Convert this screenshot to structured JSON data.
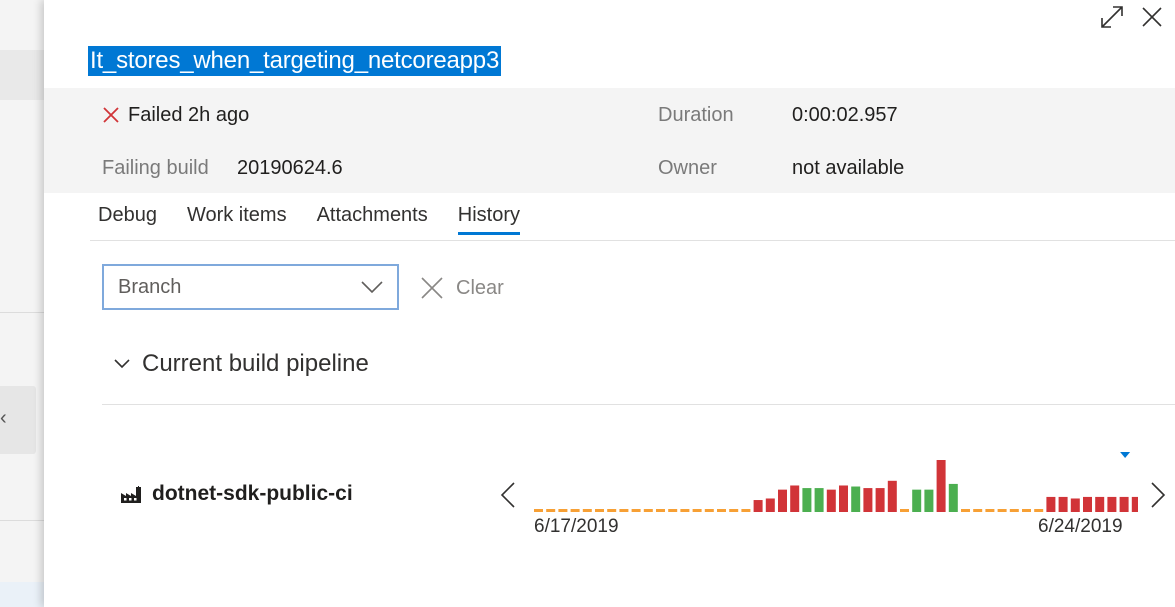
{
  "test": {
    "title": "It_stores_when_targeting_netcoreapp3"
  },
  "summary": {
    "status": "Failed 2h ago",
    "duration_label": "Duration",
    "duration_value": "0:00:02.957",
    "failing_build_label": "Failing build",
    "failing_build_value": "20190624.6",
    "owner_label": "Owner",
    "owner_value": "not available"
  },
  "tabs": [
    {
      "label": "Debug"
    },
    {
      "label": "Work items"
    },
    {
      "label": "Attachments"
    },
    {
      "label": "History",
      "active": true
    }
  ],
  "filters": {
    "branch_placeholder": "Branch",
    "clear_label": "Clear"
  },
  "section": {
    "label": "Current build pipeline"
  },
  "pipeline": {
    "name": "dotnet-sdk-public-ci"
  },
  "history": {
    "start_date": "6/17/2019",
    "end_date": "6/24/2019",
    "colors": {
      "failed": "#d13438",
      "passed": "#4caf50",
      "none": "#f7a035",
      "selected": "#0078d4"
    },
    "runs": [
      {
        "result": "none",
        "duration": 0
      },
      {
        "result": "none",
        "duration": 0
      },
      {
        "result": "none",
        "duration": 0
      },
      {
        "result": "none",
        "duration": 0
      },
      {
        "result": "none",
        "duration": 0
      },
      {
        "result": "none",
        "duration": 0
      },
      {
        "result": "none",
        "duration": 0
      },
      {
        "result": "none",
        "duration": 0
      },
      {
        "result": "none",
        "duration": 0
      },
      {
        "result": "none",
        "duration": 0
      },
      {
        "result": "none",
        "duration": 0
      },
      {
        "result": "none",
        "duration": 0
      },
      {
        "result": "none",
        "duration": 0
      },
      {
        "result": "none",
        "duration": 0
      },
      {
        "result": "none",
        "duration": 0
      },
      {
        "result": "none",
        "duration": 0
      },
      {
        "result": "none",
        "duration": 0
      },
      {
        "result": "none",
        "duration": 0
      },
      {
        "result": "failed",
        "duration": 0.23
      },
      {
        "result": "failed",
        "duration": 0.26
      },
      {
        "result": "failed",
        "duration": 0.43
      },
      {
        "result": "failed",
        "duration": 0.51
      },
      {
        "result": "passed",
        "duration": 0.46
      },
      {
        "result": "passed",
        "duration": 0.46
      },
      {
        "result": "failed",
        "duration": 0.43
      },
      {
        "result": "failed",
        "duration": 0.51
      },
      {
        "result": "passed",
        "duration": 0.49
      },
      {
        "result": "failed",
        "duration": 0.46
      },
      {
        "result": "failed",
        "duration": 0.46
      },
      {
        "result": "failed",
        "duration": 0.6
      },
      {
        "result": "none",
        "duration": 0
      },
      {
        "result": "passed",
        "duration": 0.43
      },
      {
        "result": "passed",
        "duration": 0.43
      },
      {
        "result": "failed",
        "duration": 1.0
      },
      {
        "result": "passed",
        "duration": 0.54
      },
      {
        "result": "none",
        "duration": 0
      },
      {
        "result": "none",
        "duration": 0
      },
      {
        "result": "none",
        "duration": 0
      },
      {
        "result": "none",
        "duration": 0
      },
      {
        "result": "none",
        "duration": 0
      },
      {
        "result": "none",
        "duration": 0
      },
      {
        "result": "none",
        "duration": 0
      },
      {
        "result": "failed",
        "duration": 0.29
      },
      {
        "result": "failed",
        "duration": 0.29
      },
      {
        "result": "failed",
        "duration": 0.26
      },
      {
        "result": "failed",
        "duration": 0.29
      },
      {
        "result": "failed",
        "duration": 0.29
      },
      {
        "result": "failed",
        "duration": 0.29
      },
      {
        "result": "failed",
        "duration": 0.29
      },
      {
        "result": "failed",
        "duration": 0.29
      }
    ]
  }
}
